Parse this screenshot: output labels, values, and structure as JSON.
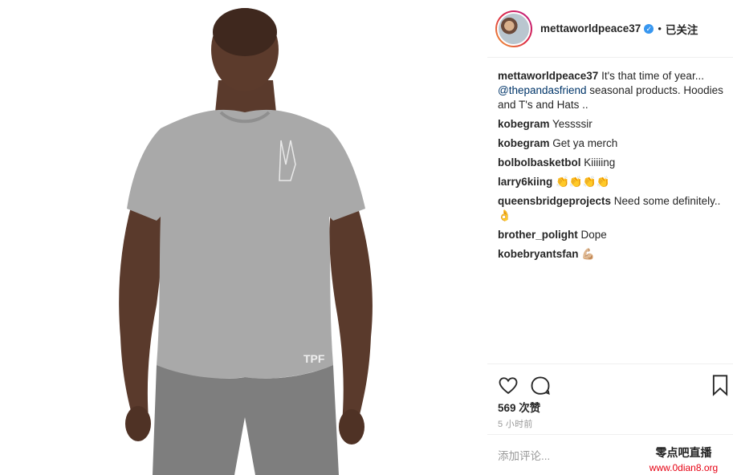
{
  "post": {
    "username": "mettaworldpeace37",
    "verified_glyph": "✓",
    "separator": "•",
    "follow_label": "已关注",
    "shirt_print": "TPF"
  },
  "comments": [
    {
      "user": "mettaworldpeace37",
      "text": " It's that time of year...",
      "mention": "@thepandasfriend",
      "rest": " seasonal products. Hoodies and T's and Hats .."
    },
    {
      "user": "kobegram",
      "text": " Yessssir"
    },
    {
      "user": "kobegram",
      "text": " Get ya merch"
    },
    {
      "user": "bolbolbasketbol",
      "text": " Kiiiiing"
    },
    {
      "user": "larry6kiing",
      "text": " 👏👏👏👏"
    },
    {
      "user": "queensbridgeprojects",
      "text": " Need some definitely..",
      "emoji": "👌"
    },
    {
      "user": "brother_polight",
      "text": " Dope"
    },
    {
      "user": "kobebryantsfan",
      "text": " ",
      "emoji": "💪🏼"
    }
  ],
  "actions": {
    "like_icon": "heart-outline",
    "comment_icon": "speech-bubble",
    "save_icon": "bookmark"
  },
  "likes": "569 次赞",
  "time": "5 小时前",
  "add_comment_placeholder": "添加评论...",
  "watermark": {
    "line1": "零点吧直播",
    "line2": "www.0dian8.org"
  },
  "colors": {
    "mention": "#003569",
    "verified": "#3897f0",
    "watermark_red": "#e60012"
  }
}
